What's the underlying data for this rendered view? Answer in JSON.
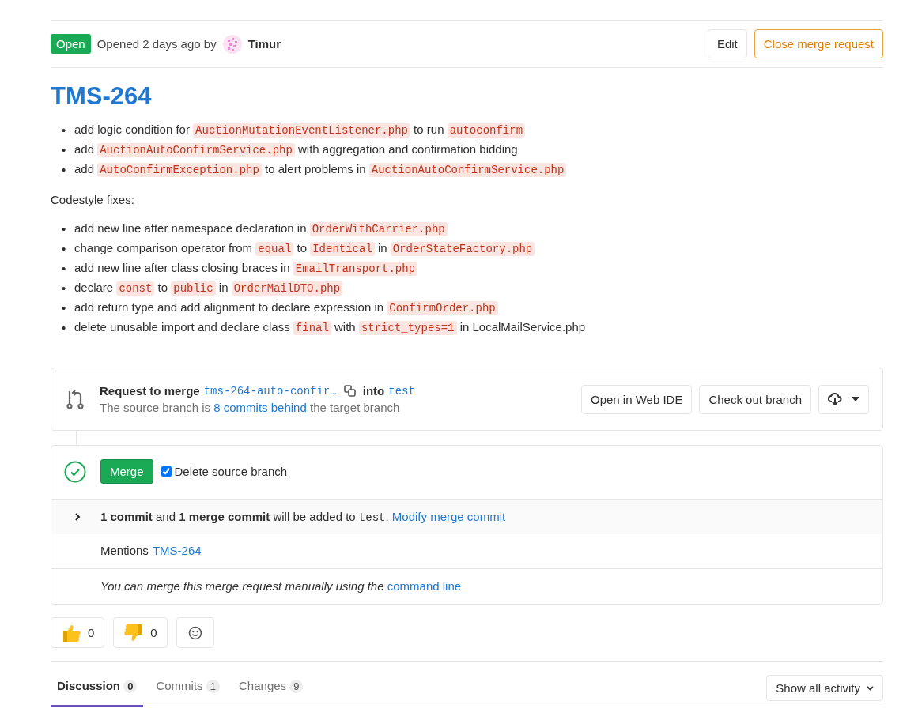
{
  "header": {
    "status": "Open",
    "opened_text": "Opened 2 days ago by",
    "author": "Timur",
    "buttons": [
      {
        "label": "Edit",
        "kind": "default"
      },
      {
        "label": "Close merge request",
        "kind": "warning"
      }
    ]
  },
  "title": "TMS-264",
  "description": {
    "bullet": "•",
    "items": [
      [
        {
          "kind": "text",
          "text": "add logic condition for "
        },
        {
          "kind": "code",
          "text": "AuctionMutationEventListener.php"
        },
        {
          "kind": "text",
          "text": " to run "
        },
        {
          "kind": "code",
          "text": "autoconfirm"
        }
      ],
      [
        {
          "kind": "text",
          "text": "add "
        },
        {
          "kind": "code",
          "text": "AuctionAutoConfirmService.php"
        },
        {
          "kind": "text",
          "text": " with aggregation and confirmation bidding"
        }
      ],
      [
        {
          "kind": "text",
          "text": "add "
        },
        {
          "kind": "code",
          "text": "AutoConfirmException.php"
        },
        {
          "kind": "text",
          "text": " to alert problems in "
        },
        {
          "kind": "code",
          "text": "AuctionAutoConfirmService.php"
        }
      ]
    ],
    "paragraph": "Codestyle fixes:",
    "fixes": [
      [
        {
          "kind": "text",
          "text": "add new line after namespace declaration in "
        },
        {
          "kind": "code",
          "text": "OrderWithCarrier.php"
        }
      ],
      [
        {
          "kind": "text",
          "text": "change comparison operator from "
        },
        {
          "kind": "code",
          "text": "equal"
        },
        {
          "kind": "text",
          "text": " to "
        },
        {
          "kind": "code",
          "text": "Identical"
        },
        {
          "kind": "text",
          "text": " in "
        },
        {
          "kind": "code",
          "text": "OrderStateFactory.php"
        }
      ],
      [
        {
          "kind": "text",
          "text": "add new line after class closing braces in "
        },
        {
          "kind": "code",
          "text": "EmailTransport.php"
        }
      ],
      [
        {
          "kind": "text",
          "text": "declare "
        },
        {
          "kind": "code",
          "text": "const"
        },
        {
          "kind": "text",
          "text": " to "
        },
        {
          "kind": "code",
          "text": "public"
        },
        {
          "kind": "text",
          "text": " in "
        },
        {
          "kind": "code",
          "text": "OrderMailDTO.php"
        }
      ],
      [
        {
          "kind": "text",
          "text": "add return type and add alignment to declare expression in "
        },
        {
          "kind": "code",
          "text": "ConfirmOrder.php"
        }
      ],
      [
        {
          "kind": "text",
          "text": "delete unusable import and declare class "
        },
        {
          "kind": "code",
          "text": "final"
        },
        {
          "kind": "text",
          "text": " with "
        },
        {
          "kind": "code",
          "text": "strict_types=1"
        },
        {
          "kind": "text",
          "text": " in LocalMailService.php"
        }
      ]
    ]
  },
  "branch_info": {
    "request_label": "Request to merge",
    "source_branch": "tms-264-auto-confir…",
    "into_label": "into",
    "target_branch": "test",
    "behind_before": "The source branch is",
    "behind_link": "8 commits behind",
    "behind_after": "the target branch",
    "buttons": [
      "Open in Web IDE",
      "Check out branch"
    ]
  },
  "merge": {
    "button": "Merge",
    "delete_source": {
      "label": "Delete source branch",
      "checked": true
    },
    "expanded": false,
    "summary": [
      {
        "kind": "text",
        "text": "**1 commit** and **1 merge commit** will be added to "
      },
      {
        "kind": "code",
        "text": "test"
      },
      {
        "kind": "text",
        "text": ". "
      },
      {
        "kind": "link",
        "text": "Modify merge commit"
      }
    ],
    "mentions_label": "Mentions",
    "mentions_link": "TMS-264",
    "manual_text": "You can merge this merge request manually using the",
    "manual_link": "command line"
  },
  "reactions": [
    {
      "kind": "thumbs_up",
      "count": "0"
    },
    {
      "kind": "thumbs_down",
      "count": "0"
    }
  ],
  "tabs": [
    {
      "label": "Discussion",
      "count": "0",
      "selected": true
    },
    {
      "label": "Commits",
      "count": "1",
      "selected": false
    },
    {
      "label": "Changes",
      "count": "9",
      "selected": false
    }
  ],
  "activity_filter": "Show all activity"
}
